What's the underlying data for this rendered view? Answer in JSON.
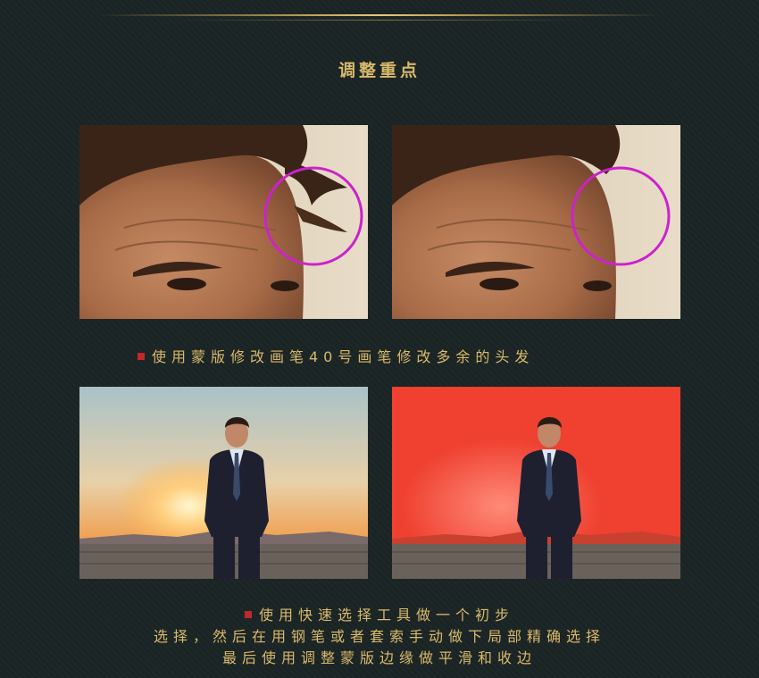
{
  "header": {
    "title": "调整重点"
  },
  "section1": {
    "caption": "使用蒙版修改画笔40号画笔修改多余的头发",
    "highlight_color": "#cc22cc"
  },
  "section2": {
    "line1": "使用快速选择工具做一个初步",
    "line2": "选择，然后在用钢笔或者套索手动做下局部精确选择",
    "line3": "最后使用调整蒙版边缘做平滑和收边"
  },
  "colors": {
    "accent": "#d9b96b",
    "bullet": "#c0282a",
    "background": "#1b2424"
  }
}
